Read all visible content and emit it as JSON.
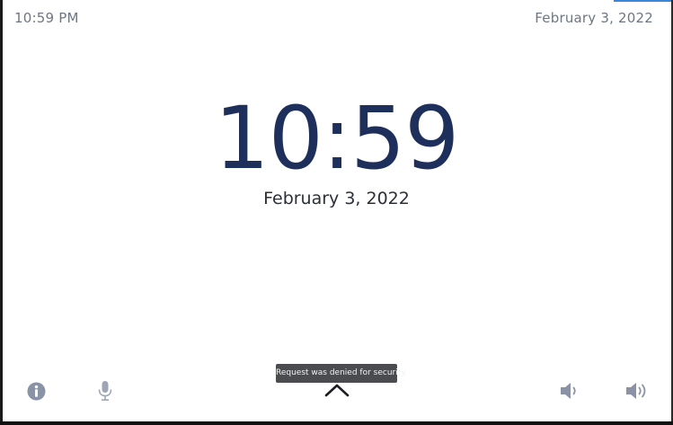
{
  "status_bar": {
    "time": "10:59 PM",
    "date": "February 3, 2022"
  },
  "clock": {
    "time": "10:59",
    "date": "February 3, 2022"
  },
  "toast": {
    "message": "Request was denied for security."
  },
  "bottom_bar": {
    "icons": [
      "info-icon",
      "microphone-icon",
      "chevron-up-icon",
      "volume-down-icon",
      "volume-up-icon"
    ]
  },
  "colors": {
    "clock_text": "#1e2f5c",
    "status_text": "#6f7683",
    "icon_gray": "#8a93a6",
    "toast_bg": "#4a4c4f",
    "accent": "#3a86d8"
  }
}
